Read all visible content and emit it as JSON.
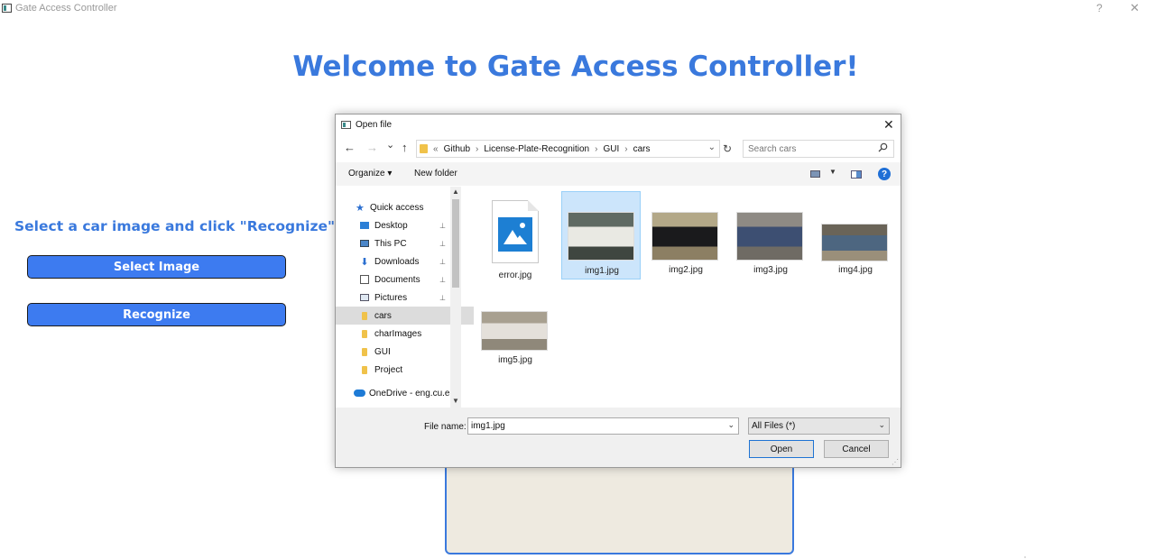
{
  "window": {
    "title": "Gate Access Controller",
    "help": "?",
    "close": "✕"
  },
  "main": {
    "welcome": "Welcome to Gate Access Controller!",
    "instruction": "Select a car image and click \"Recognize\"",
    "select_image_label": "Select Image",
    "recognize_label": "Recognize"
  },
  "dialog": {
    "title": "Open file",
    "close": "✕",
    "nav": {
      "back": "←",
      "forward": "→",
      "recent": "⌄",
      "up": "↑",
      "refresh": "↻"
    },
    "breadcrumb": {
      "overflow": "«",
      "items": [
        "Github",
        "License-Plate-Recognition",
        "GUI",
        "cars"
      ],
      "separator": "›"
    },
    "search_placeholder": "Search cars",
    "toolbar": {
      "organize": "Organize ▾",
      "new_folder": "New folder",
      "view_dd": "▼",
      "help": "?"
    },
    "sidebar": {
      "items": [
        {
          "label": "Quick access",
          "icon": "star-icon",
          "pinned": false
        },
        {
          "label": "Desktop",
          "icon": "desktop-icon",
          "pinned": true
        },
        {
          "label": "This PC",
          "icon": "computer-icon",
          "pinned": true
        },
        {
          "label": "Downloads",
          "icon": "download-icon",
          "pinned": true
        },
        {
          "label": "Documents",
          "icon": "document-icon",
          "pinned": true
        },
        {
          "label": "Pictures",
          "icon": "pictures-icon",
          "pinned": true
        },
        {
          "label": "cars",
          "icon": "folder-icon",
          "pinned": false,
          "selected": true
        },
        {
          "label": "charImages",
          "icon": "folder-icon",
          "pinned": false
        },
        {
          "label": "GUI",
          "icon": "folder-icon",
          "pinned": false
        },
        {
          "label": "Project",
          "icon": "folder-icon",
          "pinned": false
        },
        {
          "label": "OneDrive - eng.cu.ec",
          "icon": "cloud-icon",
          "pinned": false
        }
      ],
      "pin": "📌",
      "scroll_up": "▲",
      "scroll_down": "▼"
    },
    "files": [
      {
        "name": "error.jpg",
        "type": "broken-image"
      },
      {
        "name": "img1.jpg",
        "type": "photo",
        "selected": true,
        "colors": [
          "#5f6a63",
          "#e9e9e3",
          "#3f4640"
        ]
      },
      {
        "name": "img2.jpg",
        "type": "photo",
        "colors": [
          "#b3a888",
          "#1a1a1c",
          "#8c7f63"
        ]
      },
      {
        "name": "img3.jpg",
        "type": "photo",
        "colors": [
          "#8e8a84",
          "#3d4f72",
          "#6f6b64"
        ]
      },
      {
        "name": "img4.jpg",
        "type": "photo",
        "colors": [
          "#6a6458",
          "#4d6680",
          "#9a8f7a"
        ]
      },
      {
        "name": "img5.jpg",
        "type": "photo",
        "colors": [
          "#a8a090",
          "#e4e0da",
          "#8f887a"
        ]
      }
    ],
    "file_name_label": "File name:",
    "file_name_value": "img1.jpg",
    "file_type_value": "All Files (*)",
    "dropdown_arrow": "⌄",
    "open_label": "Open",
    "cancel_label": "Cancel"
  }
}
